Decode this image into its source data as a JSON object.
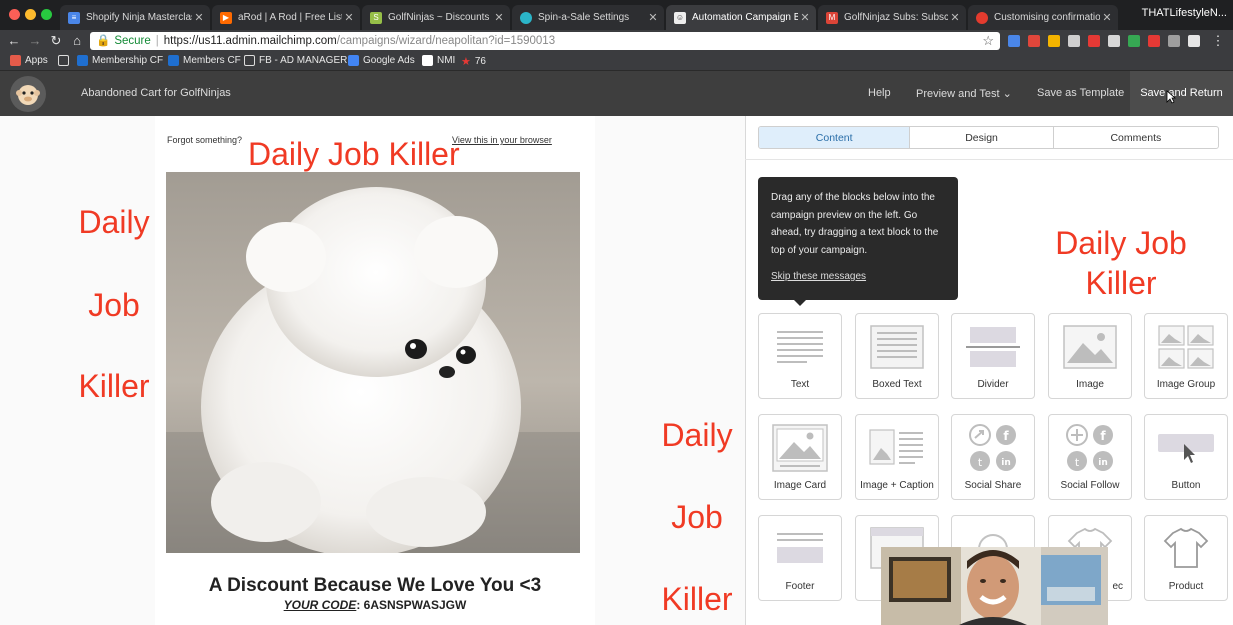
{
  "browser": {
    "tabs": [
      {
        "label": "Shopify Ninja Masterclass",
        "fav": "#4a86e8",
        "glyph": "≡"
      },
      {
        "label": "aRod | A Rod | Free Listening",
        "fav": "#ff6a00",
        "glyph": "▶"
      },
      {
        "label": "GolfNinjas ~ Discounts ~ Sh",
        "fav": "#96bf48",
        "glyph": "S"
      },
      {
        "label": "Spin-a-Sale Settings",
        "fav": "#2bb5c8",
        "glyph": "●"
      },
      {
        "label": "Automation Campaign Builder",
        "fav": "#eeeeee",
        "glyph": "☺",
        "active": true
      },
      {
        "label": "GolfNinjaz Subs: Subscriptions",
        "fav": "#db4437",
        "glyph": "M"
      },
      {
        "label": "Customising confirmation e",
        "fav": "#e33b2e",
        "glyph": "◉"
      }
    ],
    "profile": "THATLifestyleN...",
    "url": {
      "secure_label": "Secure",
      "host": "https://us11.admin.mailchimp.com",
      "path": "/campaigns/wizard/neapolitan?id=1590013"
    },
    "bookmarks": [
      "Apps",
      "Membership CF",
      "Members CF",
      "FB - AD MANAGER",
      "Google Ads",
      "NMI",
      "76"
    ]
  },
  "header": {
    "campaign_title": "Abandoned Cart for GolfNinjas",
    "help": "Help",
    "preview": "Preview and Test",
    "save_template": "Save as Template",
    "save_return": "Save and Return"
  },
  "email": {
    "forgot": "Forgot something?",
    "view_browser": "View this in your browser",
    "headline": "A Discount Because We Love You <3",
    "code_label": "YOUR CODE",
    "code_value": ": 6ASNSPWASJGW"
  },
  "overlay": {
    "top": "Daily Job Killer",
    "left": [
      "Daily",
      "Job",
      "Killer"
    ],
    "right": [
      "Daily Job",
      "Killer"
    ],
    "mid": [
      "Daily",
      "Job",
      "Killer"
    ]
  },
  "panel": {
    "tabs": [
      "Content",
      "Design",
      "Comments"
    ],
    "tooltip": "Drag any of the blocks below into the campaign preview on the left. Go ahead, try dragging a text block to the top of your campaign.",
    "skip": "Skip these messages",
    "blocks": [
      {
        "label": "Text",
        "icon": "text-block-icon"
      },
      {
        "label": "Boxed Text",
        "icon": "boxed-text-block-icon"
      },
      {
        "label": "Divider",
        "icon": "divider-block-icon"
      },
      {
        "label": "Image",
        "icon": "image-block-icon"
      },
      {
        "label": "Image Group",
        "icon": "image-group-block-icon"
      },
      {
        "label": "Image Card",
        "icon": "image-card-block-icon"
      },
      {
        "label": "Image + Caption",
        "icon": "image-caption-block-icon"
      },
      {
        "label": "Social Share",
        "icon": "social-share-block-icon"
      },
      {
        "label": "Social Follow",
        "icon": "social-follow-block-icon"
      },
      {
        "label": "Button",
        "icon": "button-block-icon"
      },
      {
        "label": "Footer",
        "icon": "footer-block-icon"
      },
      {
        "label": "",
        "icon": "code-block-icon"
      },
      {
        "label": "",
        "icon": "video-block-icon"
      },
      {
        "label": "ec",
        "icon": "product-rec-block-icon"
      },
      {
        "label": "Product",
        "icon": "product-block-icon"
      }
    ]
  },
  "colors": {
    "overlay_text": "#f03a24",
    "header_bg": "#3e3e3e",
    "active_tab": "#dfeefb",
    "secure_green": "#138a36"
  }
}
